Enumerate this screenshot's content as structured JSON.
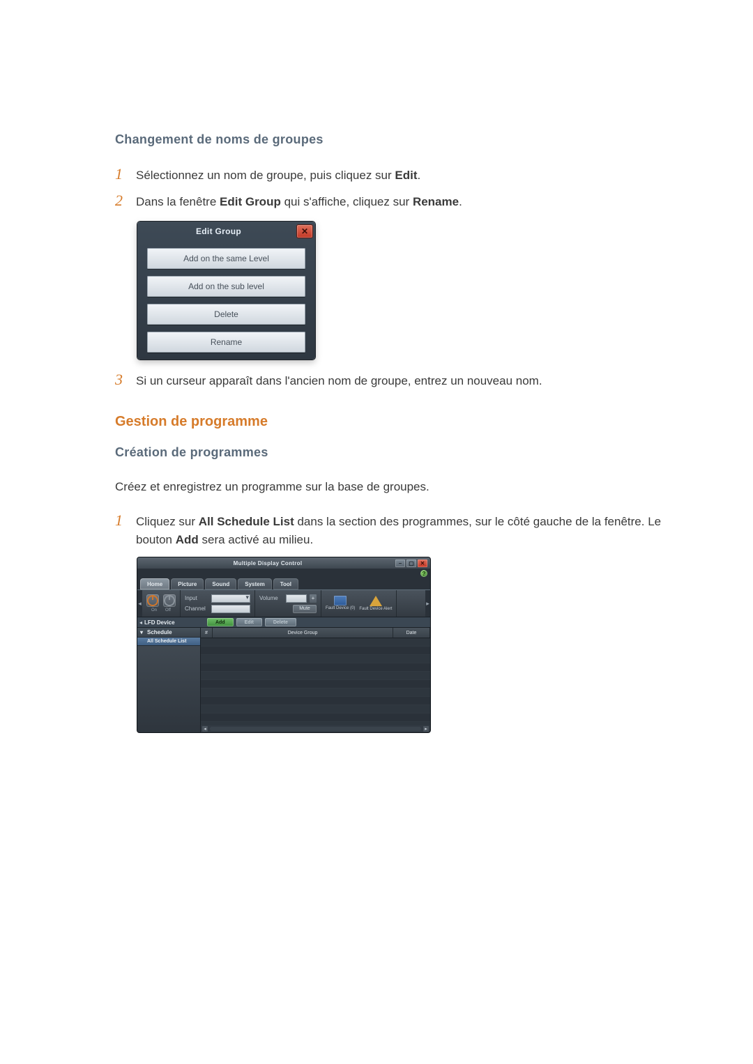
{
  "headings": {
    "group_rename": "Changement de noms de groupes",
    "schedule_mgmt": "Gestion de programme",
    "schedule_create": "Création de programmes"
  },
  "steps_rename": {
    "s1_pre": "Sélectionnez un nom de groupe, puis cliquez sur ",
    "s1_bold": "Edit",
    "s1_post": ".",
    "s2_pre": "Dans la fenêtre ",
    "s2_b1": "Edit Group",
    "s2_mid": " qui s'affiche, cliquez sur ",
    "s2_b2": "Rename",
    "s2_post": ".",
    "s3": "Si un curseur apparaît dans l'ancien nom de groupe, entrez un nouveau nom."
  },
  "schedule_intro": "Créez et enregistrez un programme sur la base de groupes.",
  "steps_schedule": {
    "s1_pre": "Cliquez sur ",
    "s1_b1": "All Schedule List",
    "s1_mid": " dans la section des programmes, sur le côté gauche de la fenêtre. Le bouton ",
    "s1_b2": "Add",
    "s1_post": " sera activé au milieu."
  },
  "nums": {
    "one": "1",
    "two": "2",
    "three": "3"
  },
  "edit_dialog": {
    "title": "Edit Group",
    "close": "✕",
    "btn_same": "Add on the same Level",
    "btn_sub": "Add on the sub level",
    "btn_delete": "Delete",
    "btn_rename": "Rename"
  },
  "mdc": {
    "title": "Multiple Display Control",
    "help": "?",
    "win": {
      "min": "–",
      "max": "▢",
      "close": "✕"
    },
    "tabs": {
      "home": "Home",
      "picture": "Picture",
      "sound": "Sound",
      "system": "System",
      "tool": "Tool"
    },
    "toolbar": {
      "on": "On",
      "off": "Off",
      "input": "Input",
      "channel": "Channel",
      "volume": "Volume",
      "mute": "Mute",
      "fault_device_count": "Fault Device (0)",
      "fault_device_alert": "Fault Device Alert",
      "arrow_l": "◂",
      "arrow_r": "▸",
      "plus": "+"
    },
    "tree": {
      "lfd": "LFD Device",
      "add": "Add",
      "edit": "Edit",
      "delete": "Delete",
      "schedule": "Schedule",
      "all_schedule": "All Schedule List"
    },
    "table": {
      "id": "#",
      "group": "Device Group",
      "date": "Date",
      "sc_l": "◂",
      "sc_r": "▸"
    }
  }
}
